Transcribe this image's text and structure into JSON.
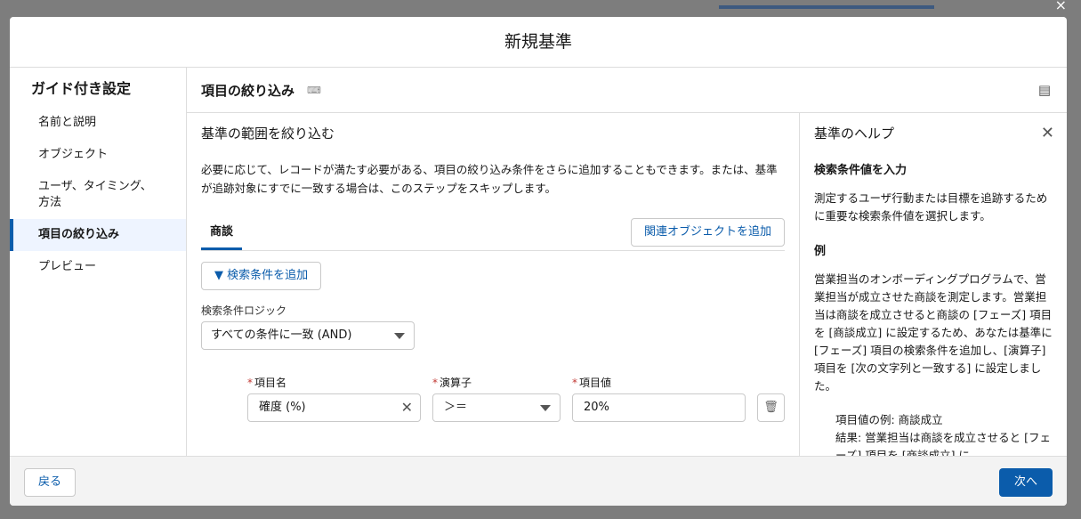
{
  "modal": {
    "title": "新規基準",
    "close": "×"
  },
  "sidebar": {
    "title": "ガイド付き設定",
    "items": [
      "名前と説明",
      "オブジェクト",
      "ユーザ、タイミング、方法",
      "項目の絞り込み",
      "プレビュー"
    ]
  },
  "main": {
    "title": "項目の絞り込み",
    "section_title": "基準の範囲を絞り込む",
    "description": "必要に応じて、レコードが満たす必要がある、項目の絞り込み条件をさらに追加することもできます。または、基準が追跡対象にすでに一致する場合は、このステップをスキップします。",
    "tab": "商談",
    "add_related": "関連オブジェクトを追加",
    "add_filter": "検索条件を追加",
    "logic_label": "検索条件ロジック",
    "logic_value": "すべての条件に一致 (AND)",
    "filter": {
      "field_label": "項目名",
      "field_value": "確度 (%)",
      "operator_label": "演算子",
      "operator_value": "＞＝",
      "value_label": "項目値",
      "value": "20%"
    }
  },
  "help": {
    "title": "基準のヘルプ",
    "heading": "検索条件値を入力",
    "text": "測定するユーザ行動または目標を追跡するために重要な検索条件値を選択します。",
    "example_heading": "例",
    "example": "営業担当のオンボーディングプログラムで、営業担当が成立させた商談を測定します。営業担当は商談を成立させると商談の [フェーズ] 項目を [商談成立] に設定するため、あなたは基準に [フェーズ] 項目の検索条件を追加し、[演算子] 項目を [次の文字列と一致する] に設定しました。",
    "ex_value": "項目値の例: 商談成立",
    "ex_result": "結果: 営業担当は商談を成立させると [フェーズ] 項目を [商談成立] に"
  },
  "footer": {
    "back": "戻る",
    "next": "次へ"
  }
}
